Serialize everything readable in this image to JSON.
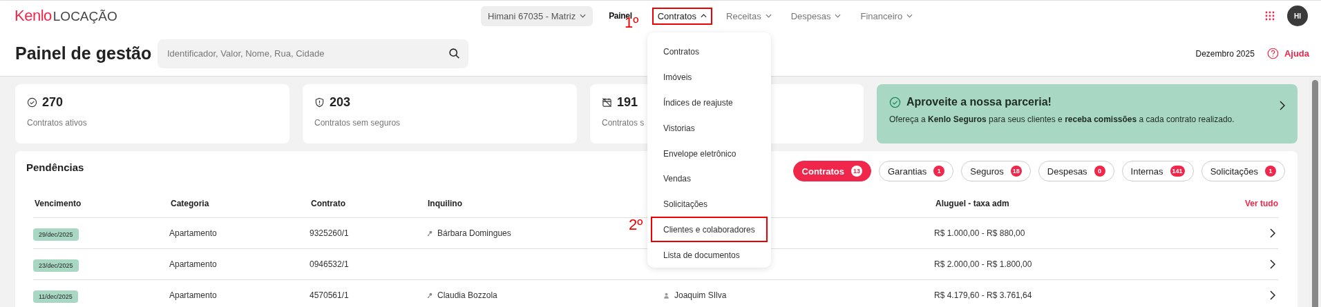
{
  "header": {
    "logo": {
      "brand": "Kenlo",
      "product": "LOCAÇÃO"
    },
    "branch_selector": "Himani 67035 - Matriz",
    "nav": [
      {
        "label": "Painel",
        "kind": "link",
        "selected": true,
        "expanded": false,
        "highlighted": false
      },
      {
        "label": "Contratos",
        "kind": "menu",
        "selected": false,
        "expanded": true,
        "highlighted": true
      },
      {
        "label": "Receitas",
        "kind": "menu",
        "selected": false,
        "expanded": false,
        "highlighted": false
      },
      {
        "label": "Despesas",
        "kind": "menu",
        "selected": false,
        "expanded": false,
        "highlighted": false
      },
      {
        "label": "Financeiro",
        "kind": "menu",
        "selected": false,
        "expanded": false,
        "highlighted": false
      }
    ],
    "avatar": "HI"
  },
  "toolbar": {
    "title": "Painel de gestão",
    "search": {
      "placeholder": "Identificador, Valor, Nome, Rua, Cidade"
    },
    "period": "Dezembro 2025",
    "help": "Ajuda"
  },
  "stats": [
    {
      "kind": "active",
      "value": "270",
      "label": "Contratos ativos"
    },
    {
      "kind": "uninsured",
      "value": "203",
      "label": "Contratos sem seguros"
    },
    {
      "kind": "expired",
      "value": "191",
      "label": "Contratos s"
    }
  ],
  "promo": {
    "title": "Aproveite a nossa parceria!",
    "text": "Ofereça a **Kenlo Seguros** para seus clientes e **receba comissões** a cada contrato realizado."
  },
  "pendencias": {
    "title": "Pendências",
    "filters": [
      {
        "label": "Contratos",
        "count": "13",
        "selected": true
      },
      {
        "label": "Garantias",
        "count": "1",
        "selected": false
      },
      {
        "label": "Seguros",
        "count": "18",
        "selected": false
      },
      {
        "label": "Despesas",
        "count": "0",
        "selected": false
      },
      {
        "label": "Internas",
        "count": "141",
        "selected": false
      },
      {
        "label": "Solicitações",
        "count": "1",
        "selected": false
      }
    ],
    "table": {
      "columns": [
        "Vencimento",
        "Categoria",
        "Contrato",
        "Inquilino",
        "Aluguel - taxa adm"
      ],
      "view_all": "Ver tudo",
      "rows": [
        {
          "due": "29/dec/2025",
          "category": "Apartamento",
          "contract": "9325260/1",
          "tenant": "Bárbara Domingues",
          "rent": "R$ 1.000,00 - R$ 880,00"
        },
        {
          "due": "23/dec/2025",
          "category": "Apartamento",
          "contract": "0946532/1",
          "rent": "R$ 2.000,00 - R$ 1.800,00"
        },
        {
          "due": "11/dec/2025",
          "category": "Apartamento",
          "contract": "4570561/1",
          "tenant": "Claudia Bozzola",
          "column_5": "Joaquim SIlva",
          "rent": "R$ 4.179,60 - R$ 3.761,64"
        }
      ]
    }
  },
  "dropdown": {
    "items": [
      {
        "label": "Contratos",
        "highlighted": false
      },
      {
        "label": "Imóveis",
        "highlighted": false
      },
      {
        "label": "Índices de reajuste",
        "highlighted": false
      },
      {
        "label": "Vistorias",
        "highlighted": false
      },
      {
        "label": "Envelope eletrônico",
        "highlighted": false
      },
      {
        "label": "Vendas",
        "highlighted": false
      },
      {
        "label": "Solicitações",
        "highlighted": false
      },
      {
        "label": "Clientes e colaboradores",
        "highlighted": true
      },
      {
        "label": "Lista de documentos",
        "highlighted": false
      }
    ]
  },
  "annotations": [
    {
      "label": "1º"
    },
    {
      "label": "2º"
    }
  ]
}
